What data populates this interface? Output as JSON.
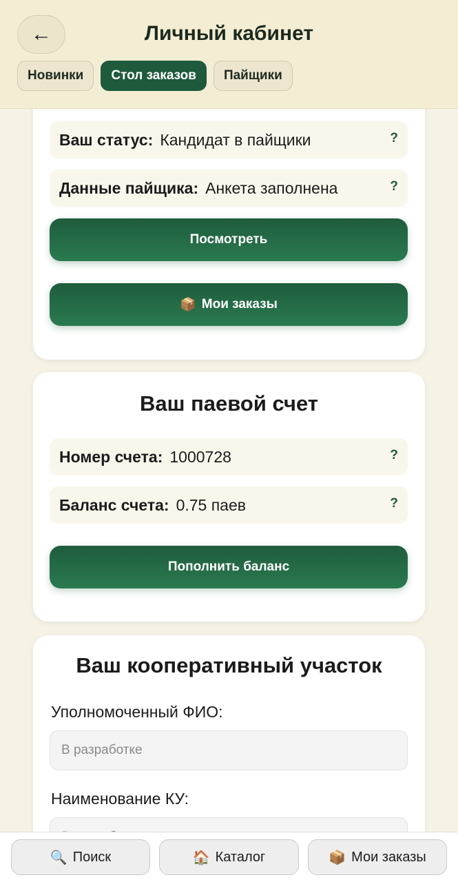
{
  "header": {
    "back_icon": "←",
    "title": "Личный кабинет",
    "tabs": [
      {
        "label": "Новинки",
        "active": false
      },
      {
        "label": "Стол заказов",
        "active": true
      },
      {
        "label": "Пайщики",
        "active": false
      }
    ]
  },
  "status_card": {
    "status_label": "Ваш статус:",
    "status_value": "Кандидат в пайщики",
    "data_label": "Данные пайщика:",
    "data_value": "Анкета заполнена",
    "help_glyph": "?",
    "view_button": "Посмотреть",
    "orders_button_icon": "📦",
    "orders_button": "Мои заказы"
  },
  "account_card": {
    "title": "Ваш паевой счет",
    "number_label": "Номер счета:",
    "number_value": "1000728",
    "balance_label": "Баланс счета:",
    "balance_value": "0.75 паев",
    "help_glyph": "?",
    "topup_button": "Пополнить баланс"
  },
  "plot_card": {
    "title": "Ваш кооперативный участок",
    "authorized_label": "Уполномоченный ФИО:",
    "authorized_placeholder": "В разработке",
    "name_label": "Наименование КУ:",
    "name_placeholder": "В разработке"
  },
  "bottom_nav": {
    "search_icon": "🔍",
    "search_label": "Поиск",
    "catalog_icon": "🏠",
    "catalog_label": "Каталог",
    "orders_icon": "📦",
    "orders_label": "Мои заказы"
  },
  "colors": {
    "accent": "#1e5a3c",
    "header_bg": "#f3edd3",
    "page_bg": "#f6f2e6"
  }
}
